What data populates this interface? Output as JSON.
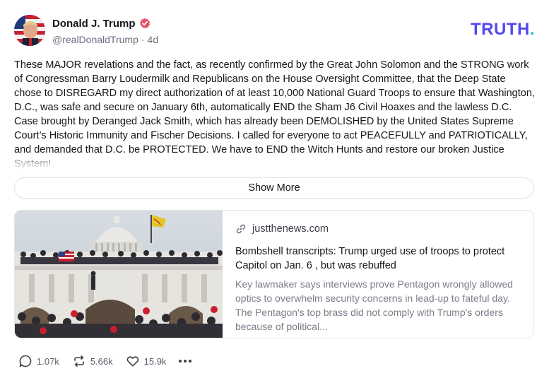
{
  "post": {
    "author": {
      "display_name": "Donald J. Trump",
      "handle": "@realDonaldTrump",
      "age": "4d",
      "separator": "·"
    },
    "brand": {
      "logo_text": "TRUTH",
      "logo_dot": ".",
      "color": "#5448EE",
      "dot_color": "#27C0A8"
    },
    "text": "These MAJOR revelations and the fact, as recently confirmed by the Great John Solomon and the STRONG work of Congressman Barry Loudermilk and Republicans on the House Oversight Committee, that the Deep State chose to DISREGARD my direct authorization of at least 10,000 National Guard Troops to ensure that Washington, D.C., was safe and secure on January 6th, automatically END the Sham J6 Civil Hoaxes and the lawless D.C. Case brought by Deranged Jack Smith, which has already been DEMOLISHED by the United States Supreme Court’s Historic Immunity and Fischer Decisions. I called for everyone to act PEACEFULLY and PATRIOTICALLY, and demanded that D.C. be PROTECTED. We have to END the Witch Hunts and restore our broken Justice System!",
    "show_more_label": "Show More",
    "link_card": {
      "domain": "justthenews.com",
      "title": "Bombshell transcripts: Trump urged use of troops to protect Capitol on Jan. 6 , but was rebuffed",
      "description": "Key lawmaker says interviews prove Pentagon wrongly allowed optics to overwhelm security concerns in lead-up to fateful day. The Pentagon's top brass did not comply with Trump's orders because of political...",
      "image_icon": "capitol-photo"
    },
    "actions": {
      "replies": "1.07k",
      "retruths": "5.66k",
      "likes": "15.9k"
    }
  },
  "colors": {
    "verified_badge": "#E4536C",
    "muted_text": "#6C7080"
  }
}
